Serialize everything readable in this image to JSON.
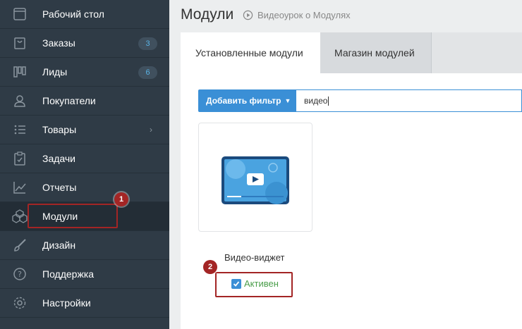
{
  "sidebar": {
    "items": [
      {
        "label": "Рабочий стол",
        "icon": "desktop-icon"
      },
      {
        "label": "Заказы",
        "icon": "orders-bag-icon",
        "badge": "3"
      },
      {
        "label": "Лиды",
        "icon": "leads-kanban-icon",
        "badge": "6"
      },
      {
        "label": "Покупатели",
        "icon": "customers-user-icon"
      },
      {
        "label": "Товары",
        "icon": "products-list-icon"
      },
      {
        "label": "Задачи",
        "icon": "tasks-clipboard-icon"
      },
      {
        "label": "Отчеты",
        "icon": "reports-chart-icon"
      },
      {
        "label": "Модули",
        "icon": "modules-cubes-icon",
        "active": true
      },
      {
        "label": "Дизайн",
        "icon": "design-brush-icon"
      },
      {
        "label": "Поддержка",
        "icon": "support-question-icon"
      },
      {
        "label": "Настройки",
        "icon": "settings-gear-icon"
      }
    ]
  },
  "header": {
    "title": "Модули",
    "video_link": "Видеоурок о Модулях"
  },
  "tabs": [
    {
      "label": "Установленные модули",
      "active": true
    },
    {
      "label": "Магазин модулей",
      "active": false
    }
  ],
  "filter": {
    "button_label": "Добавить фильтр",
    "input_value": "видео"
  },
  "module": {
    "name": "Видео-виджет",
    "status": "Активен",
    "checked": true
  },
  "annotations": {
    "one": "1",
    "two": "2"
  },
  "colors": {
    "sidebar_bg": "#2f3b46",
    "accent_blue": "#3a8fd6",
    "status_green": "#4a9e4a",
    "annotation_red": "#a32525"
  }
}
